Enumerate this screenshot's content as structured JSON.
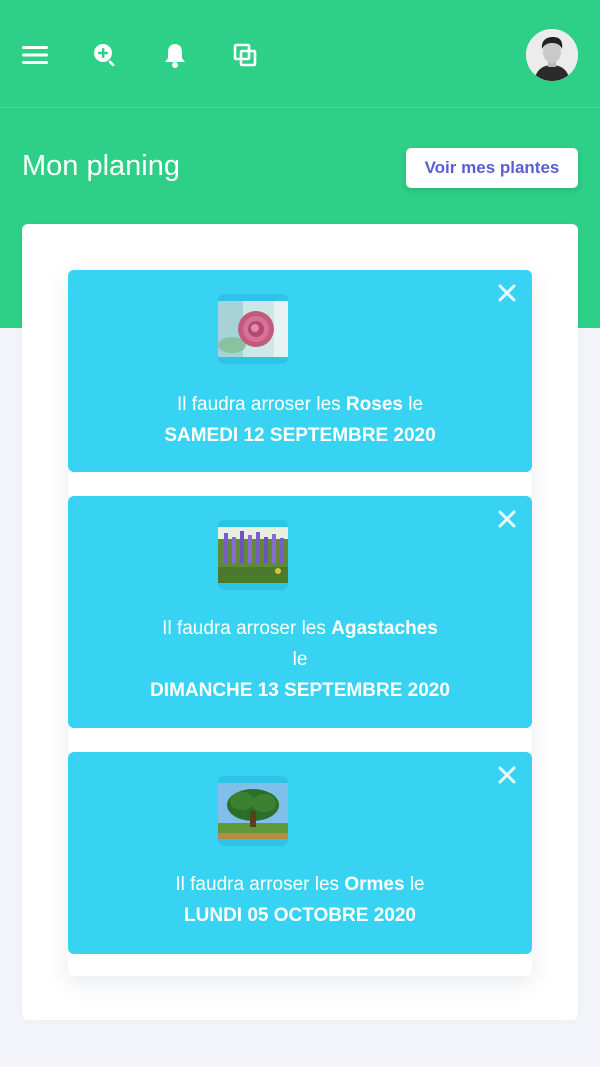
{
  "header": {
    "menu_icon": "hamburger-icon",
    "search_icon": "search-plus-icon",
    "bell_icon": "bell-icon",
    "copy_icon": "copy-icon",
    "avatar": "user-avatar"
  },
  "page": {
    "title": "Mon planing",
    "see_plants_label": "Voir mes plantes"
  },
  "reminders": [
    {
      "prefix": "Il faudra arroser les",
      "plant": "Roses",
      "suffix": "le",
      "date": "SAMEDI 12 SEPTEMBRE 2020",
      "image": "rose-photo"
    },
    {
      "prefix": "Il faudra arroser les",
      "plant": "Agastaches",
      "suffix": "le",
      "date": "DIMANCHE 13 SEPTEMBRE 2020",
      "image": "agastache-photo"
    },
    {
      "prefix": "Il faudra arroser les",
      "plant": "Ormes",
      "suffix": "le",
      "date": "LUNDI 05 OCTOBRE 2020",
      "image": "elm-tree-photo"
    }
  ],
  "colors": {
    "primary_green": "#2ecf86",
    "card_blue": "#38d3f2",
    "button_text": "#5a5fd6"
  }
}
